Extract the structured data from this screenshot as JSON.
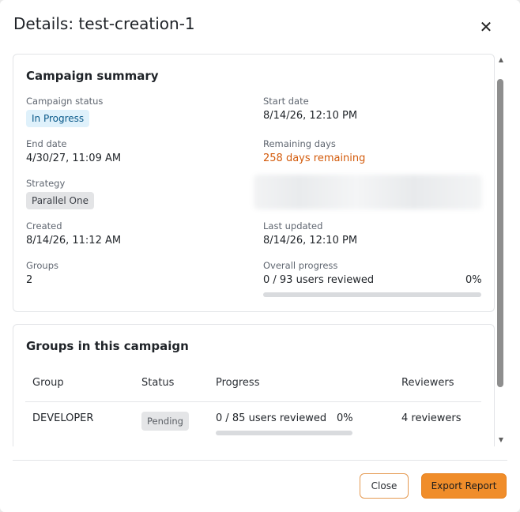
{
  "dialog": {
    "title": "Details: test-creation-1",
    "close_icon": "close-icon"
  },
  "summary": {
    "title": "Campaign summary",
    "campaign_status_label": "Campaign status",
    "campaign_status_value": "In Progress",
    "start_date_label": "Start date",
    "start_date_value": "8/14/26, 12:10 PM",
    "end_date_label": "End date",
    "end_date_value": "4/30/27, 11:09 AM",
    "remaining_days_label": "Remaining days",
    "remaining_days_value": "258 days remaining",
    "strategy_label": "Strategy",
    "strategy_value": "Parallel One",
    "created_label": "Created",
    "created_value": "8/14/26, 11:12 AM",
    "last_updated_label": "Last updated",
    "last_updated_value": "8/14/26, 12:10 PM",
    "groups_label": "Groups",
    "groups_value": "2",
    "overall_progress_label": "Overall progress",
    "overall_progress_text": "0 / 93 users reviewed",
    "overall_progress_percent": "0%",
    "overall_progress_fraction": 0
  },
  "groups": {
    "title": "Groups in this campaign",
    "columns": [
      "Group",
      "Status",
      "Progress",
      "Reviewers"
    ],
    "rows": [
      {
        "group": "DEVELOPER",
        "status": "Pending",
        "progress_text": "0 / 85 users reviewed",
        "progress_percent": "0%",
        "progress_fraction": 0,
        "reviewers": "4 reviewers"
      }
    ]
  },
  "footer": {
    "close_label": "Close",
    "export_label": "Export Report"
  },
  "colors": {
    "accent": "#f08d2a",
    "remaining_days": "#d35a0a",
    "status_badge_bg": "#dff1fb"
  }
}
